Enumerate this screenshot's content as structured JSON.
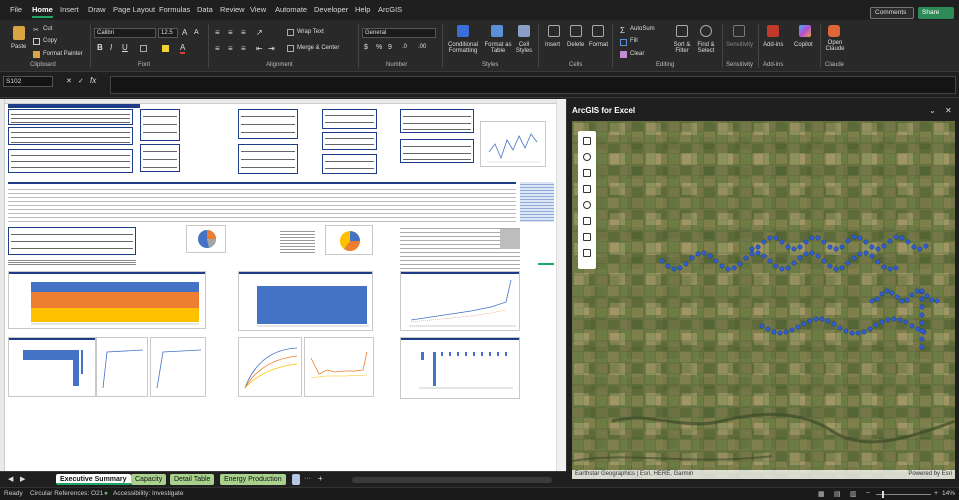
{
  "menu": [
    "File",
    "Home",
    "Insert",
    "Draw",
    "Page Layout",
    "Formulas",
    "Data",
    "Review",
    "View",
    "Automate",
    "Developer",
    "Help",
    "ArcGIS"
  ],
  "top_buttons": {
    "comments": "Comments",
    "share": "Share"
  },
  "ribbon": {
    "clipboard": {
      "paste": "Paste",
      "cut": "Cut",
      "copy": "Copy",
      "format_painter": "Format Painter",
      "label": "Clipboard"
    },
    "font": {
      "name": "Calibri",
      "size": "12.5",
      "label": "Font"
    },
    "alignment": {
      "wrap": "Wrap Text",
      "merge": "Merge & Center",
      "label": "Alignment"
    },
    "number": {
      "format": "General",
      "label": "Number"
    },
    "styles": {
      "conditional": "Conditional Formatting",
      "format_table": "Format as Table",
      "cell_styles": "Cell Styles",
      "label": "Styles"
    },
    "cells": {
      "insert": "Insert",
      "delete": "Delete",
      "format": "Format",
      "label": "Cells"
    },
    "editing": {
      "autosum": "AutoSum",
      "fill": "Fill",
      "clear": "Clear",
      "sort": "Sort & Filter",
      "find": "Find & Select",
      "label": "Editing"
    },
    "sensitivity": {
      "button": "Sensitivity",
      "label": "Sensitivity"
    },
    "addins": {
      "button": "Add-ins",
      "label": "Add-ins"
    },
    "copilot": {
      "button": "Copilot"
    },
    "claude": {
      "button": "Open Claude",
      "label": "Claude"
    }
  },
  "formula_bar": {
    "name_box": "S102",
    "fx": "fx"
  },
  "panel": {
    "title": "ArcGIS for Excel",
    "attribution": "Earthstar Geographics | Esri, HERE, Garmin",
    "powered": "Powered by Esri"
  },
  "sheet_tabs": [
    {
      "label": "Executive Summary",
      "active": true
    },
    {
      "label": "Capacity"
    },
    {
      "label": "Detail Table"
    },
    {
      "label": "Energy Production"
    }
  ],
  "status": {
    "ready": "Ready",
    "circular": "Circular References: O21",
    "accessibility": "Accessibility: Investigate",
    "zoom": "14%"
  },
  "colors": {
    "accent": "#21a366",
    "tab_green": "#a9d18e",
    "marker": "#2f5fd0"
  }
}
